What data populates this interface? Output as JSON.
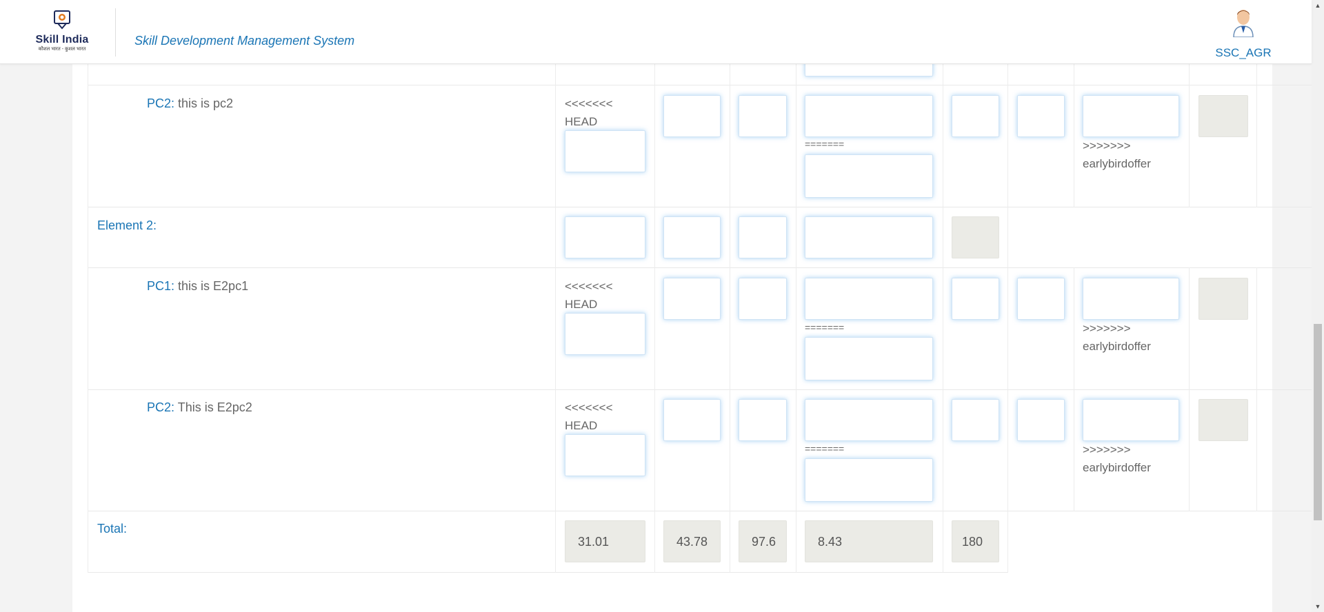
{
  "header": {
    "logo_brand": "Skill India",
    "logo_tagline": "कौशल भारत - कुशल भारत",
    "app_title": "Skill Development Management System",
    "username": "SSC_AGR"
  },
  "rows": {
    "e1pc2": {
      "key": "PC2:",
      "text": " this is pc2"
    },
    "element2": {
      "label": "Element 2:"
    },
    "e2pc1": {
      "key": "PC1:",
      "text": " this is E2pc1"
    },
    "e2pc2": {
      "key": "PC2:",
      "text": " This is E2pc2"
    },
    "total": {
      "label": "Total:"
    }
  },
  "merge_markers": {
    "head_marker": "<<<<<<<",
    "head_label": "HEAD",
    "separator": "=======",
    "tail_marker": ">>>>>>>",
    "tail_label": "earlybirdoffer"
  },
  "totals": {
    "col1": "31.01",
    "col2": "43.78",
    "col3": "97.6",
    "col4": "8.43",
    "col5": "180"
  },
  "colors": {
    "link_blue": "#1a75b5",
    "readonly_bg": "#ebebe6",
    "focus_glow": "#66afe9"
  }
}
